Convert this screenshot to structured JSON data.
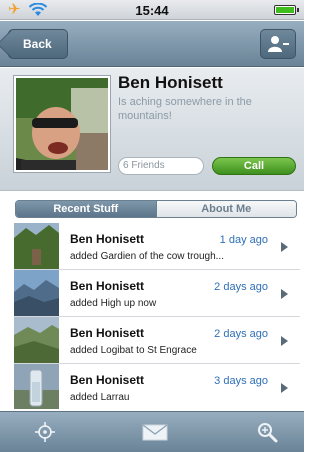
{
  "status_bar": {
    "time": "15:44",
    "icons": [
      "airplane-icon",
      "wifi-icon",
      "battery-icon"
    ]
  },
  "nav": {
    "back_label": "Back",
    "right_icon": "contact-icon"
  },
  "profile": {
    "name": "Ben Honisett",
    "status": "Is aching somewhere in the mountains!",
    "friends": "6 Friends",
    "call_label": "Call"
  },
  "segments": {
    "active": "Recent Stuff",
    "inactive": "About Me"
  },
  "activities": [
    {
      "name": "Ben Honisett",
      "time": "1 day ago",
      "desc": "added Gardien of the cow trough..."
    },
    {
      "name": "Ben Honisett",
      "time": "2 days ago",
      "desc": "added High up now"
    },
    {
      "name": "Ben Honisett",
      "time": "2 days ago",
      "desc": "added Logibat to St Engrace"
    },
    {
      "name": "Ben Honisett",
      "time": "3 days ago",
      "desc": "added Larrau"
    }
  ],
  "tab_bar": {
    "icons": [
      "location-icon",
      "mail-icon",
      "search-icon"
    ]
  },
  "colors": {
    "accent_blue": "#2f6fb6",
    "call_green": "#3e8f1f",
    "navbar": "#7a93a6"
  }
}
